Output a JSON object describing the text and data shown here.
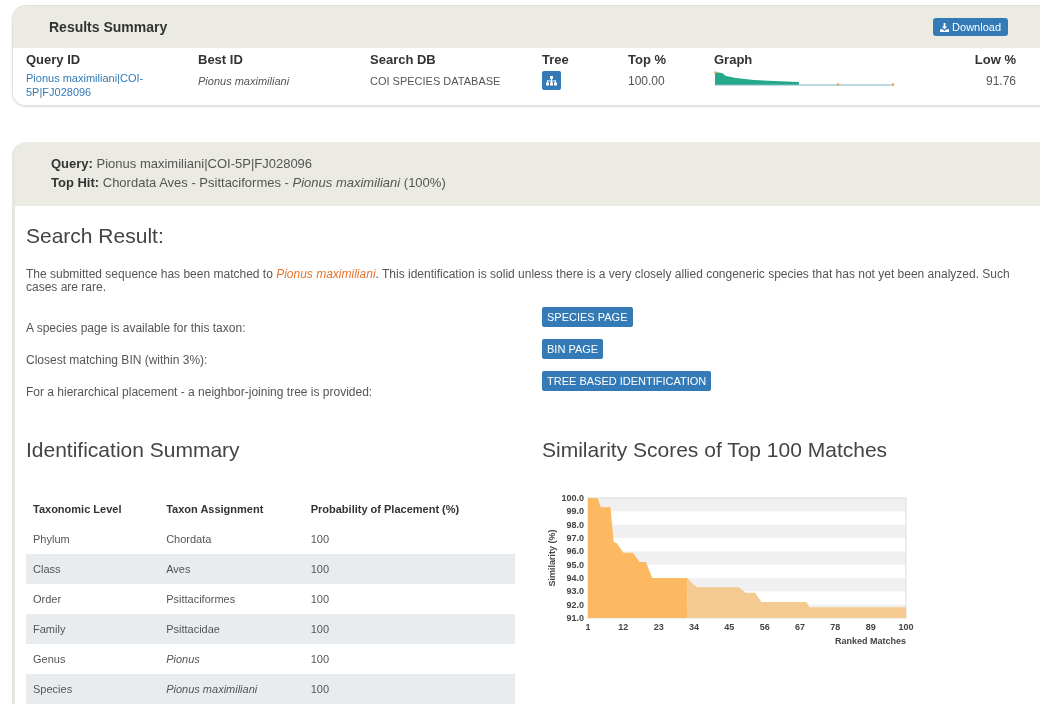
{
  "results_summary": {
    "title": "Results Summary",
    "download_button": "Download",
    "columns": [
      "Query ID",
      "Best ID",
      "Search DB",
      "Tree",
      "Top %",
      "Graph",
      "Low %"
    ],
    "row": {
      "query_id": "Pionus maximiliani|COI-5P|FJ028096",
      "best_id": "Pionus maximiliani",
      "search_db": "COI SPECIES DATABASE",
      "top_percent": "100.00",
      "low_percent": "91.76"
    }
  },
  "query": {
    "query_label": "Query:",
    "query_value": "Pionus maximiliani|COI-5P|FJ028096",
    "top_hit_label": "Top Hit:",
    "top_hit_value": "Chordata Aves - Psittaciformes - *Pionus maximiliani* (100%)"
  },
  "search_result": {
    "heading": "Search Result:",
    "summary": "The submitted sequence has been matched to *Pionus maximiliani*. This identification is solid unless there is a very closely allied congeneric species that has not yet been analyzed. Such cases are rare.",
    "links": [
      {
        "text": "A species page is available for this taxon:",
        "button": "SPECIES PAGE"
      },
      {
        "text": "Closest matching BIN (within 3%):",
        "button": "BIN PAGE"
      },
      {
        "text": "For a hierarchical placement - a neighbor-joining tree is provided:",
        "button": "TREE BASED IDENTIFICATION"
      }
    ]
  },
  "identification_summary": {
    "heading": "Identification Summary",
    "columns": [
      "Taxonomic Level",
      "Taxon Assignment",
      "Probability of Placement (%)"
    ],
    "rows": [
      {
        "level": "Phylum",
        "taxon": "Chordata",
        "probability": "100",
        "italic": false
      },
      {
        "level": "Class",
        "taxon": "Aves",
        "probability": "100",
        "italic": false
      },
      {
        "level": "Order",
        "taxon": "Psittaciformes",
        "probability": "100",
        "italic": false
      },
      {
        "level": "Family",
        "taxon": "Psittacidae",
        "probability": "100",
        "italic": false
      },
      {
        "level": "Genus",
        "taxon": "Pionus",
        "probability": "100",
        "italic": true
      },
      {
        "level": "Species",
        "taxon": "Pionus maximiliani",
        "probability": "100",
        "italic": true
      }
    ]
  },
  "similarity": {
    "heading": "Similarity Scores of Top 100 Matches",
    "chart_data": {
      "type": "area",
      "xlabel": "Ranked Matches",
      "ylabel": "Similarity (%)",
      "x": [
        1,
        4,
        5,
        8,
        9,
        10,
        12,
        15,
        17,
        19,
        21,
        32,
        33,
        35,
        48,
        50,
        53,
        55,
        69,
        70,
        100
      ],
      "series": [
        {
          "color": "#fdb961",
          "values": [
            100,
            100,
            99.3,
            99.3,
            96.7,
            96.6,
            95.9,
            95.9,
            95.2,
            95.2,
            94.0,
            94.0,
            null,
            null,
            null,
            null,
            null,
            null,
            null,
            null,
            null
          ]
        },
        {
          "color": "#f4ca91",
          "values": [
            null,
            null,
            null,
            null,
            null,
            null,
            null,
            null,
            null,
            null,
            null,
            94.0,
            93.7,
            93.3,
            93.3,
            92.9,
            92.9,
            92.2,
            92.2,
            91.8,
            91.8
          ]
        }
      ],
      "xlim": [
        1,
        100
      ],
      "ylim": [
        91,
        100
      ],
      "xticks": [
        1,
        12,
        23,
        34,
        45,
        56,
        67,
        78,
        89,
        100
      ],
      "yticks": [
        {
          "value": 91,
          "label": "91.0"
        },
        {
          "value": 92,
          "label": "92.0"
        },
        {
          "value": 93,
          "label": "93.0"
        },
        {
          "value": 94,
          "label": "94.0"
        },
        {
          "value": 95,
          "label": "95.0"
        },
        {
          "value": 96,
          "label": "96.0"
        },
        {
          "value": 97,
          "label": "97.0"
        },
        {
          "value": 98,
          "label": "98.0"
        },
        {
          "value": 99,
          "label": "99.0"
        },
        {
          "value": 100,
          "label": "100.0"
        }
      ]
    }
  }
}
